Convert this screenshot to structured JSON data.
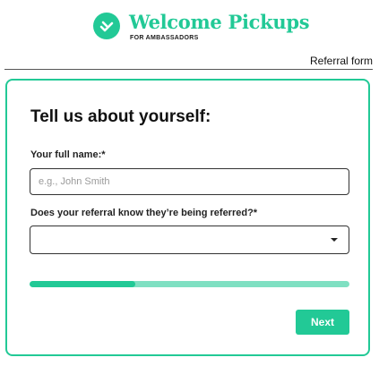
{
  "brand": {
    "name": "Welcome Pickups",
    "tagline": "FOR AMBASSADORS",
    "logo_icon": "wave-hand-icon",
    "accent_color": "#22c996"
  },
  "header": {
    "form_label": "Referral form"
  },
  "form": {
    "title": "Tell us about yourself:",
    "full_name": {
      "label": "Your full name:*",
      "placeholder": "e.g., John Smith",
      "value": ""
    },
    "referral_known": {
      "label": "Does your referral know they’re being referred?*",
      "selected": "",
      "icon": "chevron-down-icon"
    },
    "progress": {
      "fraction": 0.33,
      "track_color": "#7fe0c2"
    },
    "next_label": "Next"
  }
}
